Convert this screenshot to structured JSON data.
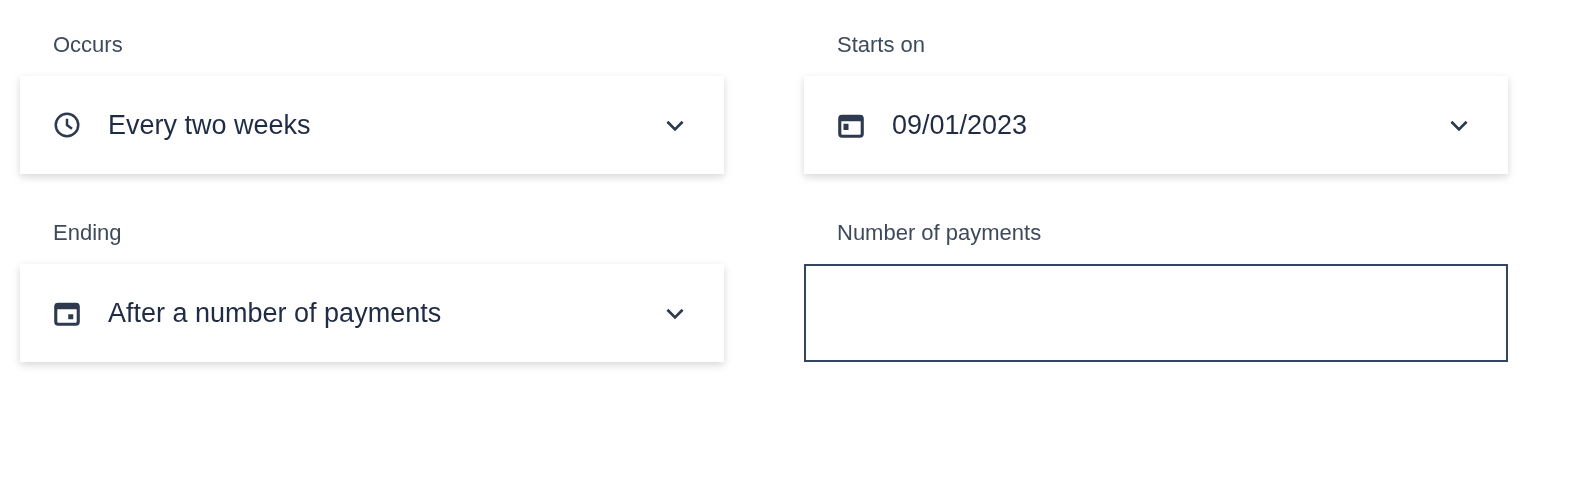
{
  "fields": [
    {
      "kind": "dropdown",
      "label": "Occurs",
      "value": "Every two weeks"
    },
    {
      "kind": "dropdown",
      "label": "Starts on",
      "value": "09/01/2023"
    },
    {
      "kind": "dropdown",
      "label": "Ending",
      "value": "After a number of payments"
    },
    {
      "kind": "input",
      "label": "Number of payments"
    }
  ]
}
